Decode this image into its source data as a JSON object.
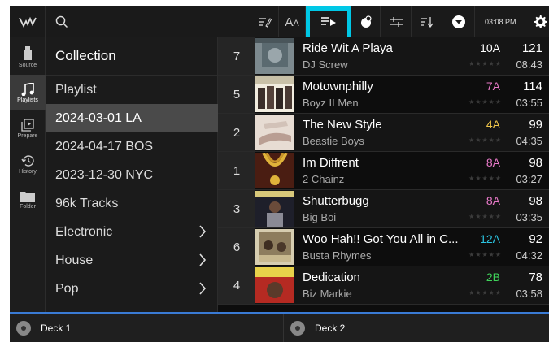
{
  "topbar": {
    "logo_icon": "brand-logo-icon",
    "search_icon": "search-icon",
    "buttons": [
      {
        "name": "edit-tags-button",
        "icon": "edit-tags-icon"
      },
      {
        "name": "text-size-button",
        "icon": "text-size-icon",
        "label": "AA"
      },
      {
        "name": "playlist-play-button",
        "icon": "playlist-play-icon",
        "highlighted": true
      },
      {
        "name": "color-button",
        "icon": "color-circle-icon"
      },
      {
        "name": "filter-button",
        "icon": "sliders-icon"
      },
      {
        "name": "sort-button",
        "icon": "sort-icon"
      },
      {
        "name": "dropdown-button",
        "icon": "chevron-down-circle-icon"
      }
    ],
    "time": "03:08 PM",
    "settings_icon": "gear-icon",
    "highlight_color": "#00c8e6"
  },
  "rail": [
    {
      "label": "Source",
      "icon": "usb-drive-icon"
    },
    {
      "label": "Playlists",
      "icon": "music-note-icon",
      "active": true
    },
    {
      "label": "Prepare",
      "icon": "prepare-icon"
    },
    {
      "label": "History",
      "icon": "history-icon"
    },
    {
      "label": "Folder",
      "icon": "folder-icon"
    }
  ],
  "browse": {
    "title": "Collection",
    "rows": [
      {
        "label": "Playlist",
        "chevron": false
      },
      {
        "label": "2024-03-01 LA",
        "chevron": false,
        "selected": true
      },
      {
        "label": "2024-04-17 BOS",
        "chevron": false
      },
      {
        "label": "2023-12-30 NYC",
        "chevron": false
      },
      {
        "label": "96k Tracks",
        "chevron": false
      },
      {
        "label": "Electronic",
        "chevron": true
      },
      {
        "label": "House",
        "chevron": true
      },
      {
        "label": "Pop",
        "chevron": true
      }
    ]
  },
  "tracks": [
    {
      "num": "7",
      "title": "Ride Wit A Playa",
      "artist": "DJ Screw",
      "key": "10A",
      "key_color": "#ffffff",
      "bpm": "121",
      "time": "08:43",
      "art": "art-screw"
    },
    {
      "num": "5",
      "title": "Motownphilly",
      "artist": "Boyz II Men",
      "key": "7A",
      "key_color": "#e879c8",
      "bpm": "114",
      "time": "03:55",
      "art": "art-boyz"
    },
    {
      "num": "2",
      "title": "The New Style",
      "artist": "Beastie Boys",
      "key": "4A",
      "key_color": "#f0c64a",
      "bpm": "99",
      "time": "04:35",
      "art": "art-beastie"
    },
    {
      "num": "1",
      "title": "Im Diffrent",
      "artist": "2 Chainz",
      "key": "8A",
      "key_color": "#e879c8",
      "bpm": "98",
      "time": "03:27",
      "art": "art-chainz"
    },
    {
      "num": "3",
      "title": "Shutterbugg",
      "artist": "Big Boi",
      "key": "8A",
      "key_color": "#e879c8",
      "bpm": "98",
      "time": "03:35",
      "art": "art-bigboi"
    },
    {
      "num": "6",
      "title": "Woo Hah!! Got You All in C...",
      "artist": "Busta Rhymes",
      "key": "12A",
      "key_color": "#2bc3e0",
      "bpm": "92",
      "time": "04:32",
      "art": "art-busta"
    },
    {
      "num": "4",
      "title": "Dedication",
      "artist": "Biz Markie",
      "key": "2B",
      "key_color": "#3fd35a",
      "bpm": "78",
      "time": "03:58",
      "art": "art-biz"
    }
  ],
  "stars": "★★★★★",
  "decks": [
    {
      "label": "Deck 1",
      "icon": "deck-disc-icon"
    },
    {
      "label": "Deck 2",
      "icon": "deck-disc-icon"
    }
  ],
  "deck_line_color": "#3a7bd5"
}
